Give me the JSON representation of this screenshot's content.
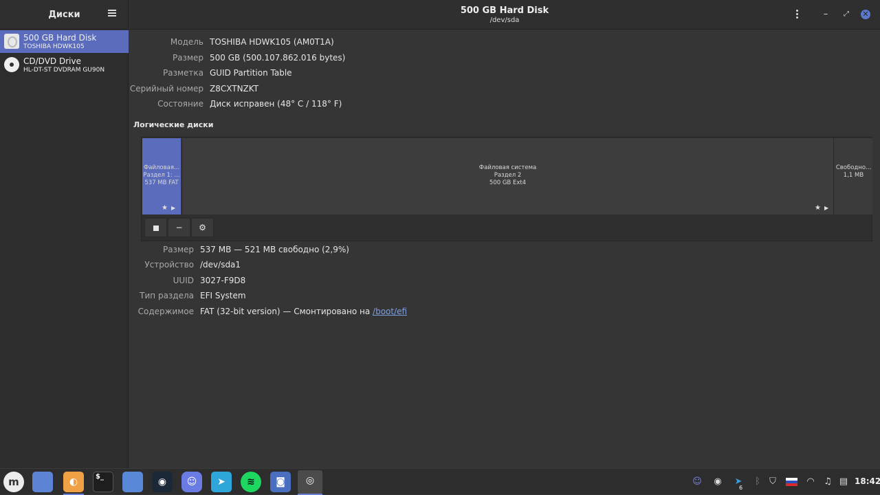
{
  "sidebar": {
    "title": "Диски",
    "drives": [
      {
        "name": "500 GB Hard Disk",
        "model": "TOSHIBA HDWK105",
        "icon": "hdd-icon"
      },
      {
        "name": "CD/DVD Drive",
        "model": "HL-DT-ST DVDRAM GU90N",
        "icon": "cd-icon"
      }
    ]
  },
  "header": {
    "title": "500 GB Hard Disk",
    "subtitle": "/dev/sda"
  },
  "disk_info": [
    {
      "key": "Модель",
      "value": "TOSHIBA HDWK105 (AM0T1A)"
    },
    {
      "key": "Размер",
      "value": "500 GB (500.107.862.016 bytes)"
    },
    {
      "key": "Разметка",
      "value": "GUID Partition Table"
    },
    {
      "key": "Серийный номер",
      "value": "Z8CXTNZKT"
    },
    {
      "key": "Состояние",
      "value": "Диск исправен (48° C / 118° F)"
    }
  ],
  "volumes_title": "Логические диски",
  "volumes": [
    {
      "l1": "Файловая...",
      "l2": "Раздел 1: ...",
      "l3": "537 MB FAT"
    },
    {
      "l1": "Файловая система",
      "l2": "Раздел 2",
      "l3": "500 GB Ext4"
    },
    {
      "l1": "Свободно...",
      "l2": "1,1 MB"
    }
  ],
  "volume_toolbar": {
    "stop": "■",
    "remove": "−",
    "settings": "⚙"
  },
  "partition_info": [
    {
      "key": "Размер",
      "value": "537 MB — 521 MB свободно (2,9%)"
    },
    {
      "key": "Устройство",
      "value": "/dev/sda1"
    },
    {
      "key": "UUID",
      "value": "3027-F9D8"
    },
    {
      "key": "Тип раздела",
      "value": "EFI System"
    },
    {
      "key": "Содержимое",
      "value": "FAT (32-bit version) — Смонтировано на ",
      "link": "/boot/efi"
    }
  ],
  "taskbar": {
    "clock": "18:42",
    "tray_badge": "6"
  },
  "colors": {
    "accent": "#5b6cbd",
    "link": "#7f9fe0",
    "close": "#5b78c9"
  }
}
